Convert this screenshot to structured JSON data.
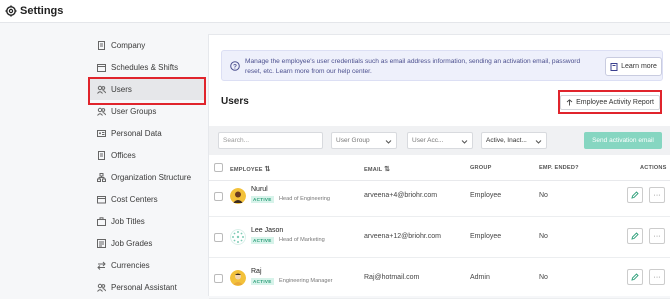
{
  "header": {
    "title": "Settings"
  },
  "sidebar": {
    "items": [
      {
        "label": "Company",
        "icon": "building-icon"
      },
      {
        "label": "Schedules & Shifts",
        "icon": "calendar-icon"
      },
      {
        "label": "Users",
        "icon": "users-icon",
        "active": true
      },
      {
        "label": "User Groups",
        "icon": "user-group-icon"
      },
      {
        "label": "Personal Data",
        "icon": "id-card-icon"
      },
      {
        "label": "Offices",
        "icon": "office-icon"
      },
      {
        "label": "Organization Structure",
        "icon": "org-chart-icon"
      },
      {
        "label": "Cost Centers",
        "icon": "wallet-icon"
      },
      {
        "label": "Job Titles",
        "icon": "briefcase-icon"
      },
      {
        "label": "Job Grades",
        "icon": "grades-icon"
      },
      {
        "label": "Currencies",
        "icon": "exchange-icon"
      },
      {
        "label": "Personal Assistant",
        "icon": "assistant-icon"
      }
    ]
  },
  "info_banner": {
    "text": "Manage the employee's user credentials such as email address information, sending an activation email, password reset, etc. Learn more from our help center.",
    "learn_more": "Learn more"
  },
  "page": {
    "title": "Users",
    "report_button": "Employee Activity Report"
  },
  "filters": {
    "search_placeholder": "Search...",
    "user_group": "User Group",
    "user_access": "User Acc...",
    "status": "Active, Inact...",
    "send_activation": "Send activation email"
  },
  "table": {
    "columns": {
      "employee": "EMPLOYEE",
      "email": "EMAIL",
      "group": "GROUP",
      "emp_ended": "EMP. ENDED?",
      "actions": "ACTIONS"
    },
    "rows": [
      {
        "name": "Nurul",
        "status": "ACTIVE",
        "role": "Head of Engineering",
        "email": "arveena+4@briohr.com",
        "group": "Employee",
        "ended": "No"
      },
      {
        "name": "Lee Jason",
        "status": "ACTIVE",
        "role": "Head of Marketing",
        "email": "arveena+12@briohr.com",
        "group": "Employee",
        "ended": "No"
      },
      {
        "name": "Raj",
        "status": "ACTIVE",
        "role": "Engineering Manager",
        "email": "Raj@hotmail.com",
        "group": "Admin",
        "ended": "No"
      }
    ]
  },
  "colors": {
    "accent_teal": "#86d6c1",
    "highlight_red": "#e0242c",
    "info_bg": "#eef0fb",
    "badge_green": "#2a9d77"
  }
}
